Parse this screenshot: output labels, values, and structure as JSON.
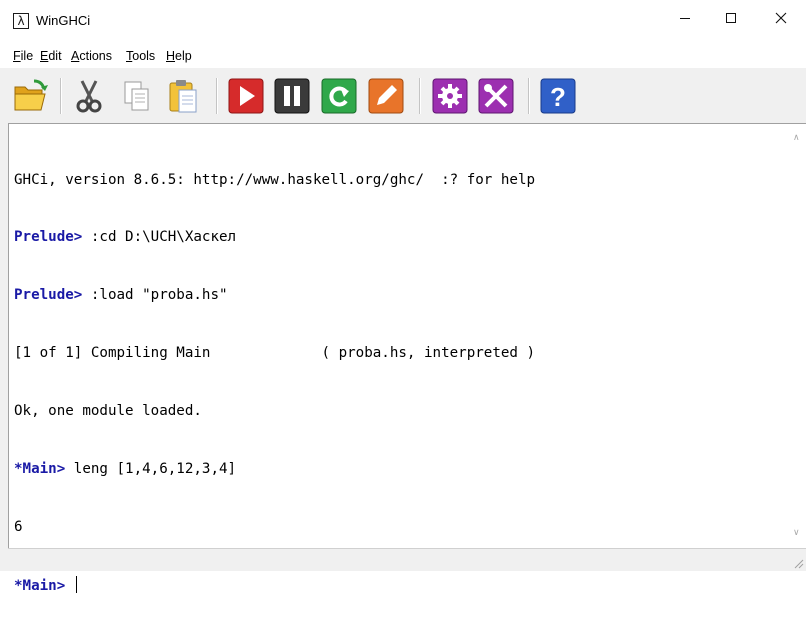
{
  "window": {
    "title": "WinGHCi"
  },
  "menu": [
    {
      "label": "File",
      "accel": "F",
      "rest": "ile"
    },
    {
      "label": "Edit",
      "accel": "E",
      "rest": "dit"
    },
    {
      "label": "Actions",
      "accel": "A",
      "rest": "ctions"
    },
    {
      "label": "Tools",
      "accel": "T",
      "rest": "ools"
    },
    {
      "label": "Help",
      "accel": "H",
      "rest": "elp"
    }
  ],
  "toolbar": {
    "buttons": [
      {
        "icon": "open-folder-icon"
      },
      {
        "icon": "cut-icon"
      },
      {
        "icon": "copy-icon"
      },
      {
        "icon": "paste-icon"
      },
      {
        "icon": "run-icon"
      },
      {
        "icon": "pause-icon"
      },
      {
        "icon": "reload-icon"
      },
      {
        "icon": "edit-icon"
      },
      {
        "icon": "options-icon"
      },
      {
        "icon": "tools-icon"
      },
      {
        "icon": "help-icon"
      }
    ]
  },
  "console": {
    "lines": [
      {
        "prompt": "",
        "text": "GHCi, version 8.6.5: http://www.haskell.org/ghc/  :? for help"
      },
      {
        "prompt": "Prelude>",
        "text": " :cd D:\\UCH\\Хаскел"
      },
      {
        "prompt": "Prelude>",
        "text": " :load \"proba.hs\""
      },
      {
        "prompt": "",
        "text": "[1 of 1] Compiling Main             ( proba.hs, interpreted )"
      },
      {
        "prompt": "",
        "text": "Ok, one module loaded."
      },
      {
        "prompt": "*Main>",
        "text": " leng [1,4,6,12,3,4]"
      },
      {
        "prompt": "",
        "text": "6"
      },
      {
        "prompt": "*Main>",
        "text": " "
      }
    ]
  },
  "colors": {
    "prompt": "#1a1aa6",
    "red": "#d62b2b",
    "purple": "#9c2fb0",
    "green": "#2fa84a",
    "orange": "#e8742a",
    "blue": "#3060c8"
  }
}
